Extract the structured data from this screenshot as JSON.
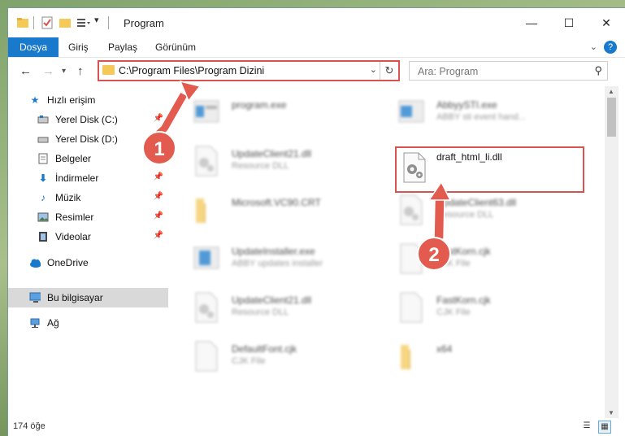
{
  "window": {
    "title": "Program",
    "controls": {
      "minimize": "—",
      "maximize": "☐",
      "close": "✕"
    }
  },
  "ribbon": {
    "tabs": [
      "Dosya",
      "Giriş",
      "Paylaş",
      "Görünüm"
    ],
    "help": "?"
  },
  "nav": {
    "address": "C:\\Program Files\\Program Dizini",
    "search_placeholder": "Ara: Program"
  },
  "sidebar": {
    "items": [
      {
        "label": "Hızlı erişim",
        "icon": "star-icon",
        "pinned": false
      },
      {
        "label": "Yerel Disk (C:)",
        "icon": "drive-icon",
        "pinned": true
      },
      {
        "label": "Yerel Disk (D:)",
        "icon": "drive-icon",
        "pinned": true
      },
      {
        "label": "Belgeler",
        "icon": "documents-icon",
        "pinned": true
      },
      {
        "label": "İndirmeler",
        "icon": "download-icon",
        "pinned": true
      },
      {
        "label": "Müzik",
        "icon": "music-icon",
        "pinned": true
      },
      {
        "label": "Resimler",
        "icon": "pictures-icon",
        "pinned": true
      },
      {
        "label": "Videolar",
        "icon": "video-icon",
        "pinned": true
      },
      {
        "label": "OneDrive",
        "icon": "cloud-icon",
        "pinned": false
      },
      {
        "label": "Bu bilgisayar",
        "icon": "computer-icon",
        "pinned": false
      },
      {
        "label": "Ağ",
        "icon": "network-icon",
        "pinned": false
      }
    ]
  },
  "files": [
    {
      "name": "program.exe",
      "type": "",
      "icon": "exe-icon"
    },
    {
      "name": "AbbyySTI.exe",
      "type": "ABBY sti event hand...",
      "icon": "exe-icon"
    },
    {
      "name": "UpdateClient21.dll",
      "type": "Resource DLL",
      "icon": "dll-icon"
    },
    {
      "name": "draft_html_li.dll",
      "type": "",
      "icon": "dll-icon"
    },
    {
      "name": "Microsoft.VC90.CRT",
      "type": "",
      "icon": "folder-icon"
    },
    {
      "name": "UpdateClient63.dll",
      "type": "Resource DLL",
      "icon": "dll-icon"
    },
    {
      "name": "UpdateInstaller.exe",
      "type": "ABBY updates installer",
      "icon": "exe-icon"
    },
    {
      "name": "FastKorn.cjk",
      "type": "CJK File",
      "icon": "file-icon"
    },
    {
      "name": "UpdateClient21.dll",
      "type": "Resource DLL",
      "icon": "dll-icon"
    },
    {
      "name": "FastKorn.cjk",
      "type": "CJK File",
      "icon": "file-icon"
    },
    {
      "name": "DefaultFont.cjk",
      "type": "CJK File",
      "icon": "file-icon"
    },
    {
      "name": "x64",
      "type": "",
      "icon": "folder-icon"
    }
  ],
  "status": {
    "count": "174 öğe"
  },
  "callouts": [
    "1",
    "2"
  ],
  "colors": {
    "accent": "#1979ca",
    "highlight": "#d9534f",
    "callout": "#e25b4e"
  }
}
